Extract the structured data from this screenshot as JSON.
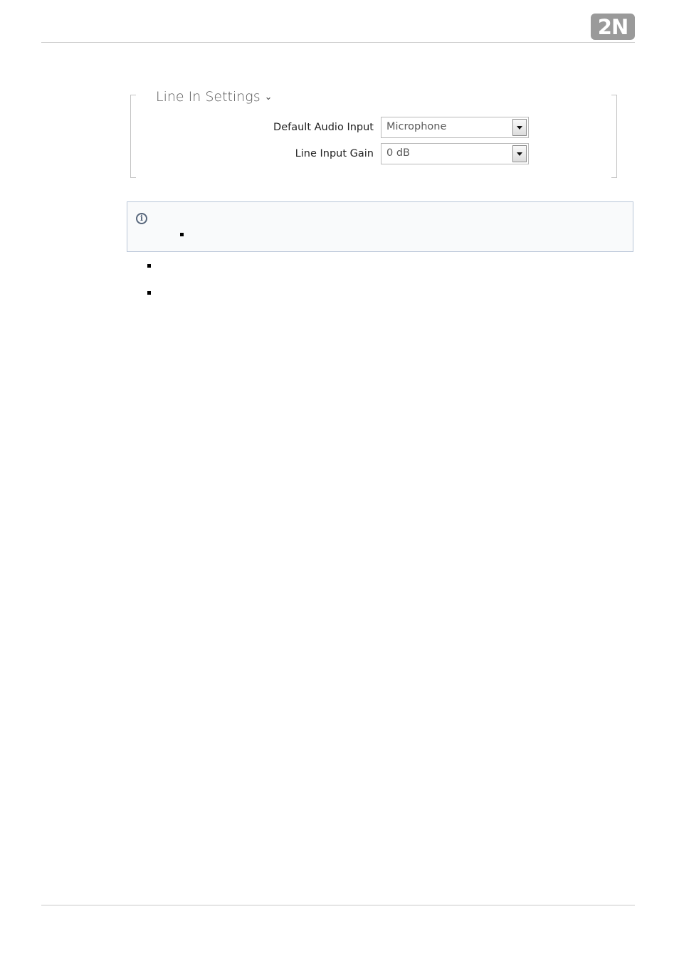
{
  "header": {
    "logo_text": "2N"
  },
  "section": {
    "title": "Line In Settings",
    "chevron": "⌄"
  },
  "fields": [
    {
      "label": "Default Audio Input",
      "value": "Microphone"
    },
    {
      "label": "Line Input Gain",
      "value": "0 dB"
    }
  ],
  "info": {
    "icon": "info-icon",
    "glyph": "i"
  },
  "colors": {
    "logo_bg": "#9a9a9a",
    "info_border": "#b9c6d8",
    "info_icon": "#58677c"
  }
}
